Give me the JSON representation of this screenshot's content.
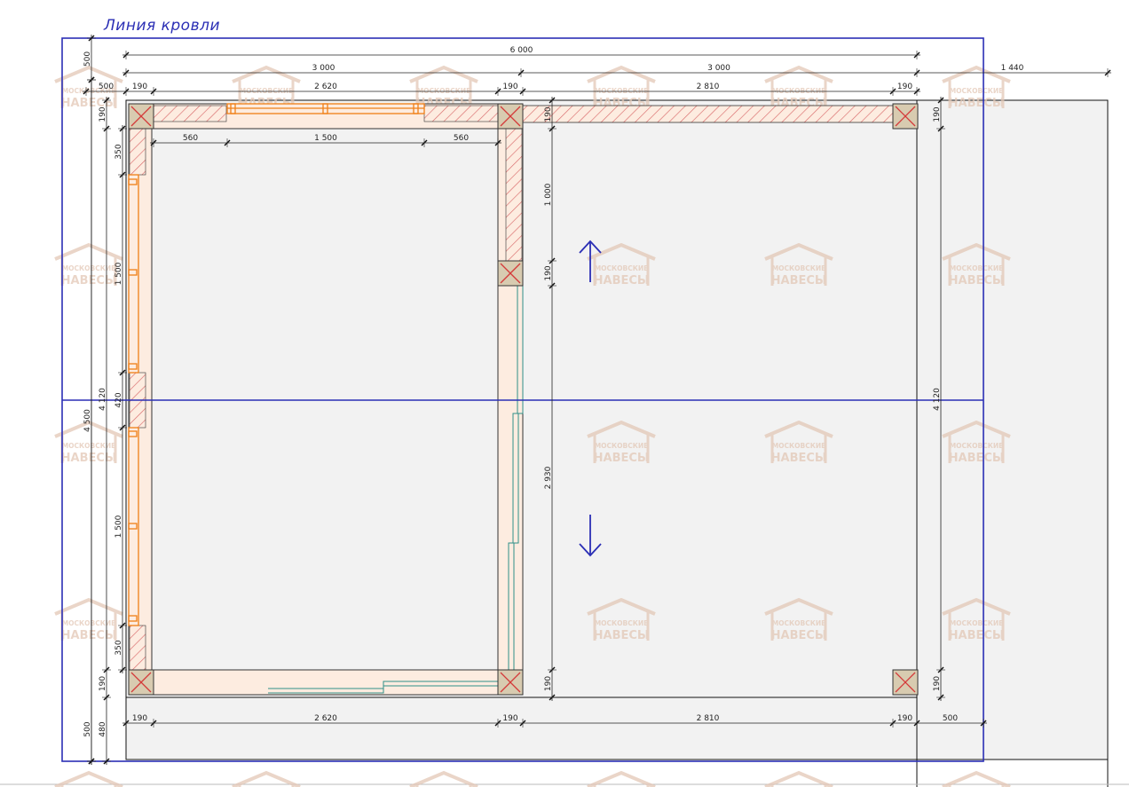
{
  "drawing": {
    "roof_line_label": "Линия кровли",
    "watermark": {
      "line1": "МОСКОВСКИЕ",
      "line2": "НАВЕСЫ"
    },
    "arrows": [
      "up",
      "down"
    ]
  },
  "dimensions": {
    "top_total": "6 000",
    "top_half_left": "3 000",
    "top_half_right": "3 000",
    "top_right_ext": "1 440",
    "top_edge_left": "500",
    "top_post_1": "190",
    "top_span_left": "2 620",
    "top_post_2": "190",
    "top_span_right": "2 810",
    "top_post_3": "190",
    "window_left": "560",
    "window_middle": "1 500",
    "window_right": "560",
    "left_outer_top": "500",
    "left_post_top": "190",
    "left_seg_1": "350",
    "left_seg_2": "1 500",
    "left_seg_3": "420",
    "left_seg_4": "1 500",
    "left_seg_5": "350",
    "left_post_bottom": "190",
    "left_overall": "4 500",
    "left_inner": "4 120",
    "left_outer_bottom": "500",
    "left_outer_480": "480",
    "mid_post_top": "190",
    "mid_seg_1": "1 000",
    "mid_post_mid": "190",
    "mid_seg_2": "2 930",
    "mid_post_bottom": "190",
    "right_post_top": "190",
    "right_inner": "4 120",
    "right_post_bottom": "190",
    "bottom_post_1": "190",
    "bottom_span_left": "2 620",
    "bottom_post_2": "190",
    "bottom_span_right": "2 810",
    "bottom_post_3": "190",
    "bottom_right_ext": "500"
  },
  "colors": {
    "roof_line": "#2b2fb5",
    "wall_hatch": "#d96b6b",
    "wall_fill": "#fdece0",
    "window": "#f07f16",
    "post_fill": "#d8cbb0",
    "post_cross": "#d43a3a",
    "floor": "#f2f2f2",
    "door_line": "#2f8f88",
    "watermark": "#e3c8b6"
  }
}
